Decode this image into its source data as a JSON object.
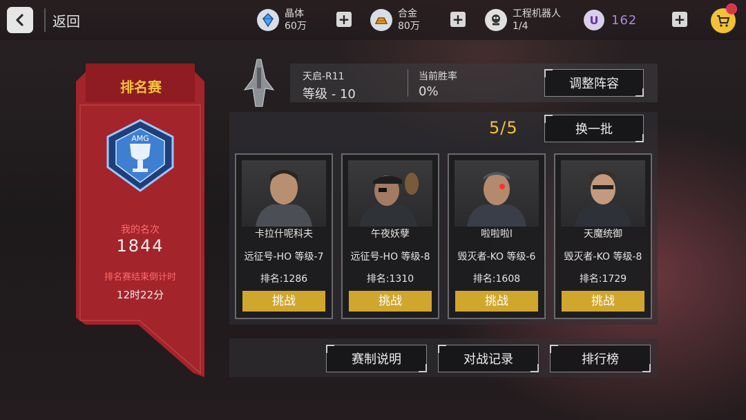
{
  "header": {
    "back_label": "返回",
    "resources": [
      {
        "name": "晶体",
        "value": "60万",
        "icon": "crystal-icon"
      },
      {
        "name": "合金",
        "value": "80万",
        "icon": "alloy-icon"
      },
      {
        "name": "工程机器人",
        "value": "1/4",
        "icon": "robot-icon"
      }
    ],
    "u_currency": {
      "symbol": "U",
      "value": "162"
    }
  },
  "banner": {
    "title": "排名赛",
    "emblem_text": "AMG",
    "my_rank_label": "我的名次",
    "my_rank_value": "1844",
    "countdown_label": "排名赛结束倒计时",
    "countdown_value": "12时22分"
  },
  "ship": {
    "name": "天启-R11",
    "level": "等级 - 10",
    "winrate_label": "当前胜率",
    "winrate_value": "0%",
    "adjust_button": "调整阵容"
  },
  "opponents": {
    "count": "5/5",
    "refresh_button": "换一批",
    "list": [
      {
        "name": "卡拉什呢科夫",
        "ship": "远征号-HO 等级-7",
        "rank": "排名:1286",
        "button": "挑战"
      },
      {
        "name": "午夜妖孽",
        "ship": "远征号-HO 等级-8",
        "rank": "排名:1310",
        "button": "挑战"
      },
      {
        "name": "啦啦啦l",
        "ship": "毁灭者-KO 等级-6",
        "rank": "排名:1608",
        "button": "挑战"
      },
      {
        "name": "天魔统御",
        "ship": "毁灭者-KO 等级-8",
        "rank": "排名:1729",
        "button": "挑战"
      }
    ]
  },
  "footer": {
    "rules_button": "赛制说明",
    "records_button": "对战记录",
    "leaderboard_button": "排行榜"
  },
  "colors": {
    "accent_gold": "#d1a62d",
    "banner_red": "#b0262b",
    "rank_red": "#ff6b6b"
  }
}
